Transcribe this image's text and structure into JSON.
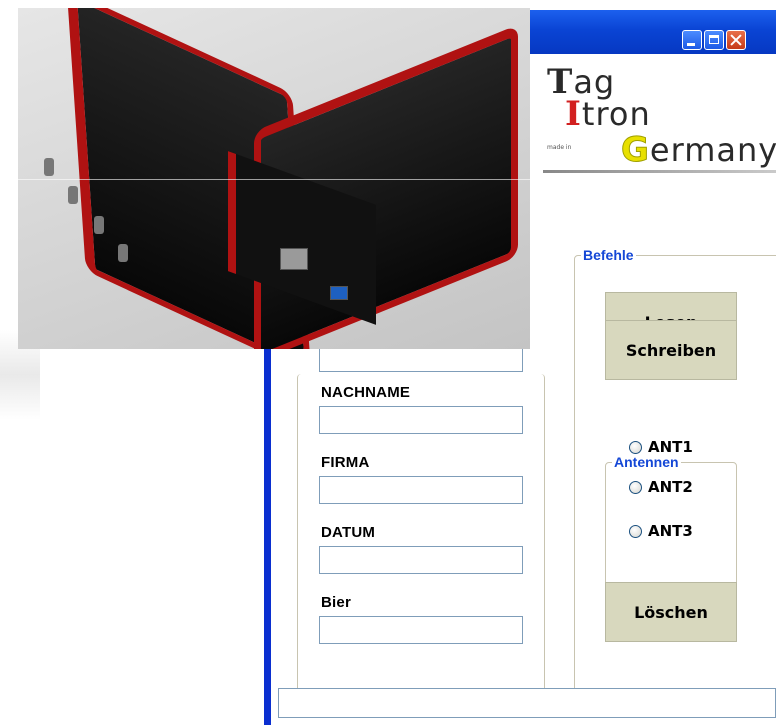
{
  "window": {
    "controls": {
      "minimize": "minimize",
      "maximize": "maximize",
      "close": "close"
    }
  },
  "logo": {
    "line1_initial": "T",
    "line1_rest": "ag",
    "line2_initial": "I",
    "line2_rest": "tron",
    "line3_initial": "G",
    "line3_rest": "ermany",
    "made_in": "made in"
  },
  "form": {
    "fields": [
      {
        "label": "NACHNAME",
        "value": ""
      },
      {
        "label": "FIRMA",
        "value": ""
      },
      {
        "label": "DATUM",
        "value": ""
      },
      {
        "label": "Bier",
        "value": ""
      }
    ],
    "top_field_value": ""
  },
  "befehle": {
    "title": "Befehle",
    "buttons": {
      "lesen": "Lesen",
      "schreiben": "Schreiben",
      "loeschen": "Löschen"
    }
  },
  "antennen": {
    "title": "Antennen",
    "options": [
      "ANT1",
      "ANT2",
      "ANT3"
    ],
    "selected": null
  },
  "statusbar": {
    "text": ""
  },
  "icons": [
    "minimize-icon",
    "maximize-icon",
    "close-icon",
    "radio-icon"
  ],
  "colors": {
    "title_bar": "#0a44d4",
    "group_title": "#1447d6",
    "button_face": "#d8d8be",
    "device_red": "#b01212"
  }
}
